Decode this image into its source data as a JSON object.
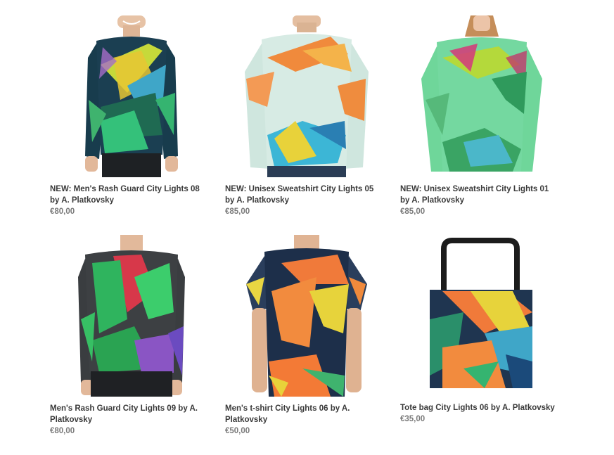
{
  "products": [
    {
      "title": "NEW: Men's Rash Guard City Lights 08 by A. Platkovsky",
      "price": "€80,00",
      "image": "mens-rash-guard-image"
    },
    {
      "title": "NEW: Unisex Sweatshirt City Lights 05 by A. Platkovsky",
      "price": "€85,00",
      "image": "unisex-sweatshirt-image"
    },
    {
      "title": "NEW: Unisex Sweatshirt City Lights 01 by A. Platkovsky",
      "price": "€85,00",
      "image": "unisex-sweatshirt-image"
    },
    {
      "title": "Men's Rash Guard City Lights 09 by A. Platkovsky",
      "price": "€80,00",
      "image": "mens-rash-guard-image"
    },
    {
      "title": "Men's t-shirt City Lights 06 by A. Platkovsky",
      "price": "€50,00",
      "image": "mens-tshirt-image"
    },
    {
      "title": "Tote bag City Lights 06 by A. Platkovsky",
      "price": "€35,00",
      "image": "tote-bag-image"
    }
  ]
}
